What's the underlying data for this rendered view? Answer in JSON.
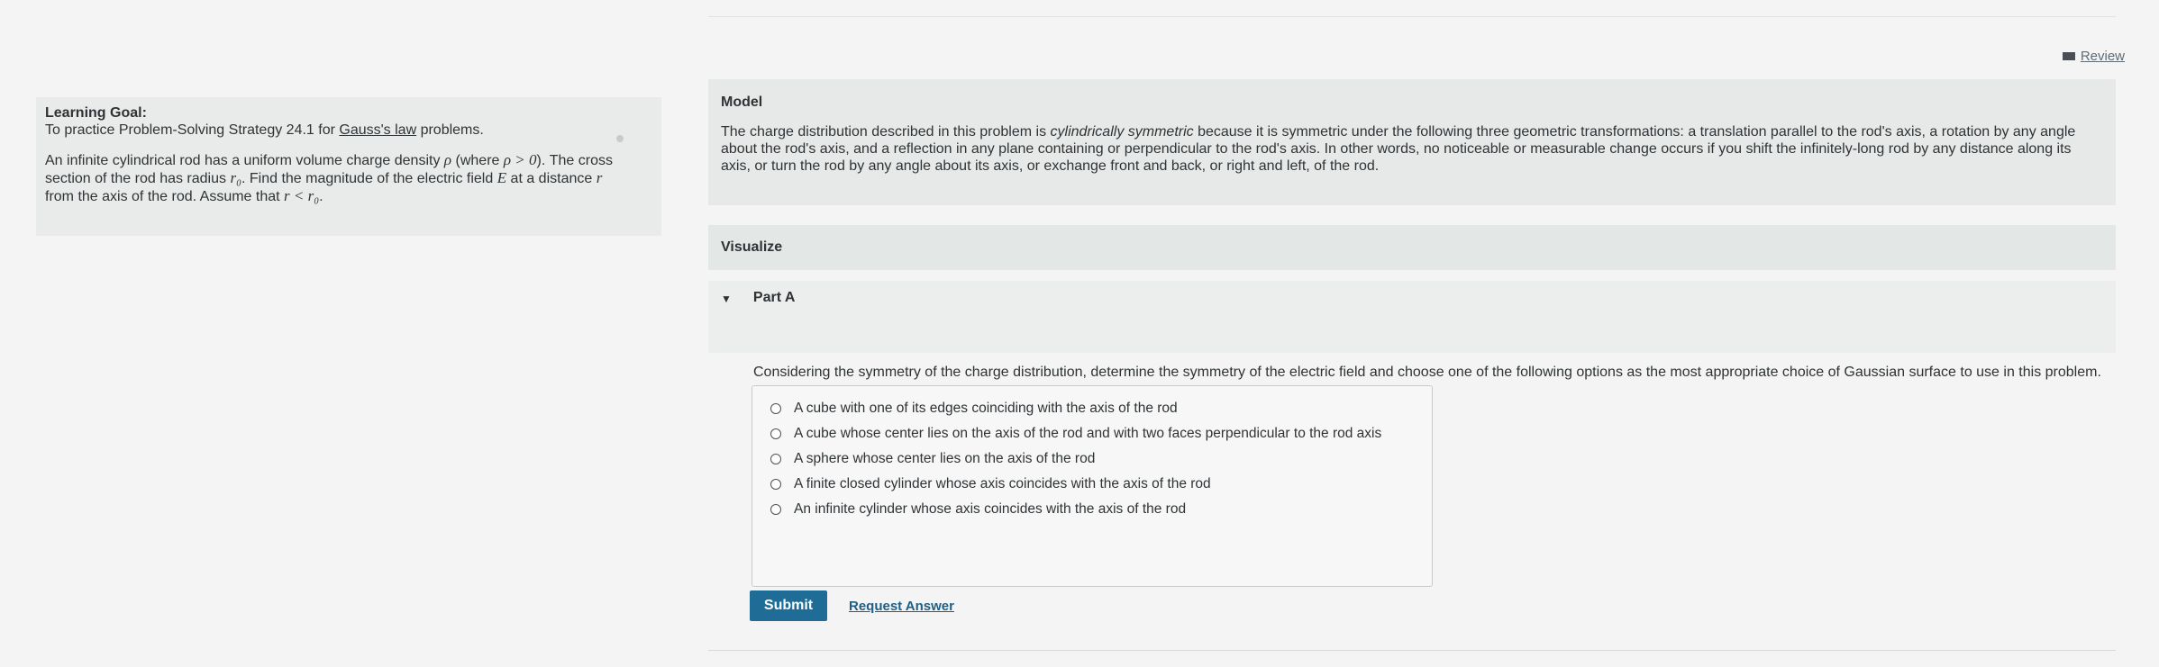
{
  "review": {
    "label": "Review",
    "icon": "book-icon"
  },
  "learning_goal": {
    "title": "Learning Goal:",
    "text_before_link": "To practice Problem-Solving Strategy 24.1 for ",
    "link": "Gauss's law",
    "text_after_link": " problems.",
    "problem_part1": "An infinite cylindrical rod has a uniform volume charge density ",
    "rho_sym": "ρ",
    "problem_part2": " (where ",
    "rho_cond": "ρ > 0",
    "problem_part3": "). The cross section of the rod has radius ",
    "r0_sym": "r₀",
    "problem_part4": ". Find the magnitude of the electric field ",
    "e_sym": "E",
    "problem_part5": " at a distance ",
    "r_sym": "r",
    "problem_part6": " from the axis of the rod. Assume that ",
    "r_cond": "r < r₀",
    "problem_part7": "."
  },
  "model": {
    "title": "Model",
    "text_part1": "The charge distribution described in this problem is ",
    "emphasis": "cylindrically symmetric",
    "text_part2": " because it is symmetric under the following three geometric transformations: a translation parallel to the rod's axis, a rotation by any angle about the rod's axis, and a reflection in any plane containing or perpendicular to the rod's axis. In other words, no noticeable or measurable change occurs if you shift the infinitely-long rod by any distance along its axis, or turn the rod by any angle about its axis, or exchange front and back, or right and left, of the rod."
  },
  "visualize": {
    "title": "Visualize"
  },
  "part_a": {
    "title": "Part A",
    "question": "Considering the symmetry of the charge distribution, determine the symmetry of the electric field and choose one of the following options as the most appropriate choice of Gaussian surface to use in this problem.",
    "options": [
      "A cube with one of its edges coinciding with the axis of the rod",
      "A cube whose center lies on the axis of the rod and with two faces perpendicular to the rod axis",
      "A sphere whose center lies on the axis of the rod",
      "A finite closed cylinder whose axis coincides with the axis of the rod",
      "An infinite cylinder whose axis coincides with the axis of the rod"
    ],
    "submit": "Submit",
    "request_answer": "Request Answer"
  }
}
